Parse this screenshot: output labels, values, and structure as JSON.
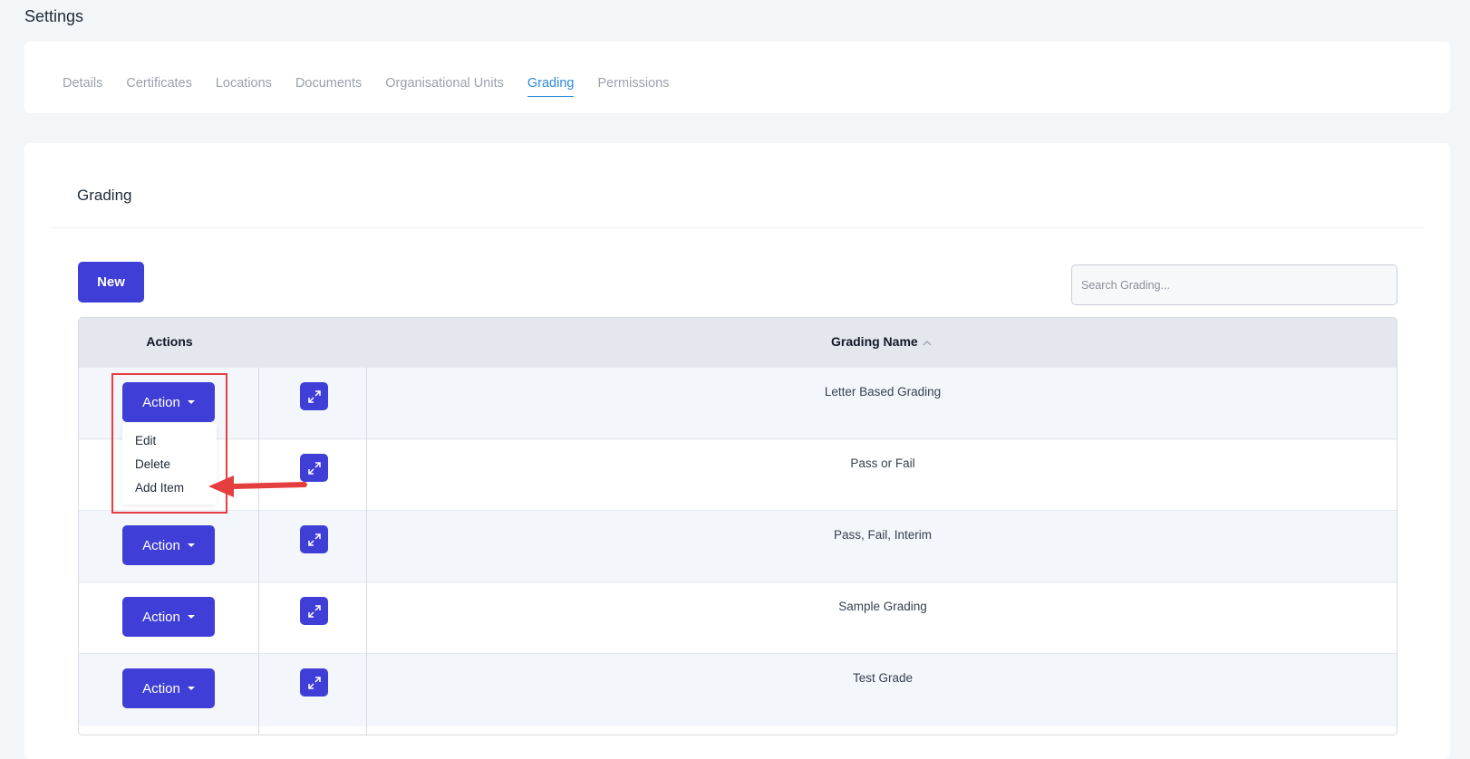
{
  "page_title": "Settings",
  "tabs": [
    {
      "label": "Details",
      "active": false
    },
    {
      "label": "Certificates",
      "active": false
    },
    {
      "label": "Locations",
      "active": false
    },
    {
      "label": "Documents",
      "active": false
    },
    {
      "label": "Organisational Units",
      "active": false
    },
    {
      "label": "Grading",
      "active": true
    },
    {
      "label": "Permissions",
      "active": false
    }
  ],
  "section": {
    "title": "Grading",
    "new_label": "New",
    "search_placeholder": "Search Grading..."
  },
  "table": {
    "headers": {
      "actions": "Actions",
      "name": "Grading Name"
    },
    "action_label": "Action",
    "rows": [
      {
        "name": "Letter Based Grading"
      },
      {
        "name": "Pass or Fail"
      },
      {
        "name": "Pass, Fail, Interim"
      },
      {
        "name": "Sample Grading"
      },
      {
        "name": "Test Grade"
      }
    ]
  },
  "dropdown": {
    "items": [
      {
        "label": "Edit"
      },
      {
        "label": "Delete"
      },
      {
        "label": "Add Item"
      }
    ]
  },
  "colors": {
    "primary": "#3f3ed6",
    "active_tab": "#2b8ad8",
    "annotation": "#e53e3e"
  }
}
